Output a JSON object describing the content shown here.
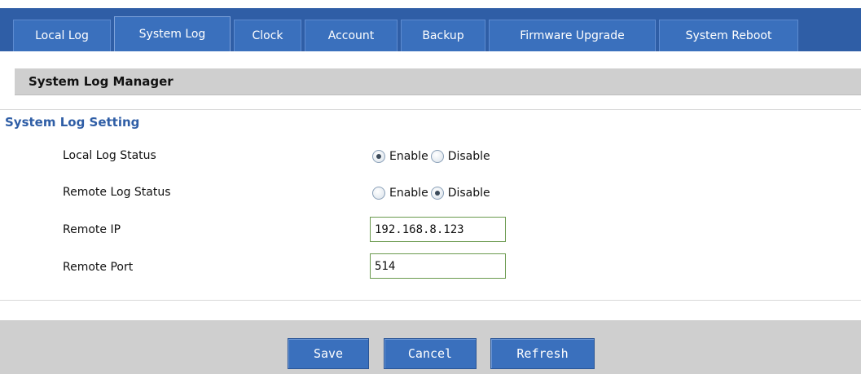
{
  "tabs": [
    {
      "label": "Local Log"
    },
    {
      "label": "System Log"
    },
    {
      "label": "Clock"
    },
    {
      "label": "Account"
    },
    {
      "label": "Backup"
    },
    {
      "label": "Firmware Upgrade"
    },
    {
      "label": "System Reboot"
    }
  ],
  "active_tab": "System Log",
  "section": {
    "title": "System Log Manager"
  },
  "setting": {
    "title": "System Log Setting",
    "local_log_status": {
      "label": "Local Log Status",
      "options": [
        "Enable",
        "Disable"
      ],
      "selected": "Enable"
    },
    "remote_log_status": {
      "label": "Remote Log Status",
      "options": [
        "Enable",
        "Disable"
      ],
      "selected": "Disable"
    },
    "remote_ip": {
      "label": "Remote IP",
      "value": "192.168.8.123"
    },
    "remote_port": {
      "label": "Remote Port",
      "value": "514"
    }
  },
  "buttons": {
    "save": "Save",
    "cancel": "Cancel",
    "refresh": "Refresh"
  },
  "colors": {
    "tab_bar": "#2f5ea6",
    "tab": "#3a70bd",
    "accent_title": "#2f5ea6",
    "section_bar": "#cfcfcf",
    "input_border": "#6a9a4e"
  }
}
